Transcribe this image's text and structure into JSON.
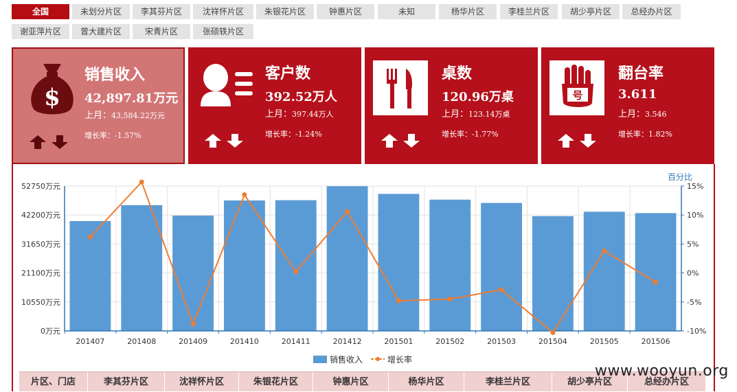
{
  "tabs": [
    {
      "label": "全国",
      "active": true
    },
    {
      "label": "未划分片区"
    },
    {
      "label": "李其芬片区"
    },
    {
      "label": "沈祥怀片区"
    },
    {
      "label": "朱银花片区"
    },
    {
      "label": "钟惠片区"
    },
    {
      "label": "未知"
    },
    {
      "label": "杨华片区"
    },
    {
      "label": "李桂兰片区"
    },
    {
      "label": "胡少亭片区"
    },
    {
      "label": "总经办片区"
    },
    {
      "label": "谢亚萍片区"
    },
    {
      "label": "曾大建片区"
    },
    {
      "label": "宋青片区"
    },
    {
      "label": "张硕轶片区"
    }
  ],
  "cards": [
    {
      "title": "销售收入",
      "value": "42,897.81万元",
      "last_prefix": "上月：",
      "last_value": "43,584.22万元",
      "growth": "增长率：-1.57%",
      "icon": "money-bag-icon",
      "active": true
    },
    {
      "title": "客户数",
      "value": "392.52万人",
      "last_prefix": "上月：",
      "last_value": "397.44万人",
      "growth": "增长率：-1.24%",
      "icon": "customer-list-icon"
    },
    {
      "title": "桌数",
      "value": "120.96万桌",
      "last_prefix": "上月：",
      "last_value": "123.14万桌",
      "growth": "增长率：-1.77%",
      "icon": "fork-knife-icon"
    },
    {
      "title": "翻台率",
      "value": "3.611",
      "last_prefix": "上月：",
      "last_value": "3.546",
      "growth": "增长率：1.82%",
      "icon": "hand-number-icon"
    }
  ],
  "chart_data": {
    "type": "bar",
    "categories": [
      "201407",
      "201408",
      "201409",
      "201410",
      "201411",
      "201412",
      "201501",
      "201502",
      "201503",
      "201504",
      "201505",
      "201506"
    ],
    "series": [
      {
        "name": "销售收入",
        "type": "bar",
        "axis": "left",
        "color": "#5b9bd5",
        "values": [
          40000,
          45800,
          42000,
          47500,
          47600,
          52700,
          49900,
          47800,
          46600,
          41800,
          43400,
          42900
        ]
      },
      {
        "name": "增长率",
        "type": "line",
        "axis": "right",
        "color": "#ed7d31",
        "values": [
          6.2,
          15.7,
          -8.8,
          13.5,
          0.2,
          10.6,
          -4.8,
          -4.5,
          -2.9,
          -10.3,
          3.8,
          -1.6
        ]
      }
    ],
    "y_left": {
      "ticks": [
        0,
        10550,
        21100,
        31650,
        42200,
        52750
      ],
      "tick_labels": [
        "0万元",
        "10550万元",
        "21100万元",
        "31650万元",
        "42200万元",
        "52750万元"
      ],
      "range": [
        0,
        52750
      ]
    },
    "y_right": {
      "label": "百分比",
      "ticks": [
        -10,
        -5,
        0,
        5,
        10,
        15
      ],
      "tick_labels": [
        "-10%",
        "-5%",
        "0%",
        "5%",
        "10%",
        "15%"
      ],
      "range": [
        -10,
        15
      ]
    },
    "legend": [
      "销售收入",
      "增长率"
    ],
    "legend_position": "bottom",
    "grid": true
  },
  "table": {
    "headers": [
      "片区、门店",
      "李其芬片区",
      "沈祥怀片区",
      "朱银花片区",
      "钟惠片区",
      "杨华片区",
      "李桂兰片区",
      "胡少亭片区",
      "总经办片区"
    ]
  },
  "watermark": "www.wooyun.org"
}
